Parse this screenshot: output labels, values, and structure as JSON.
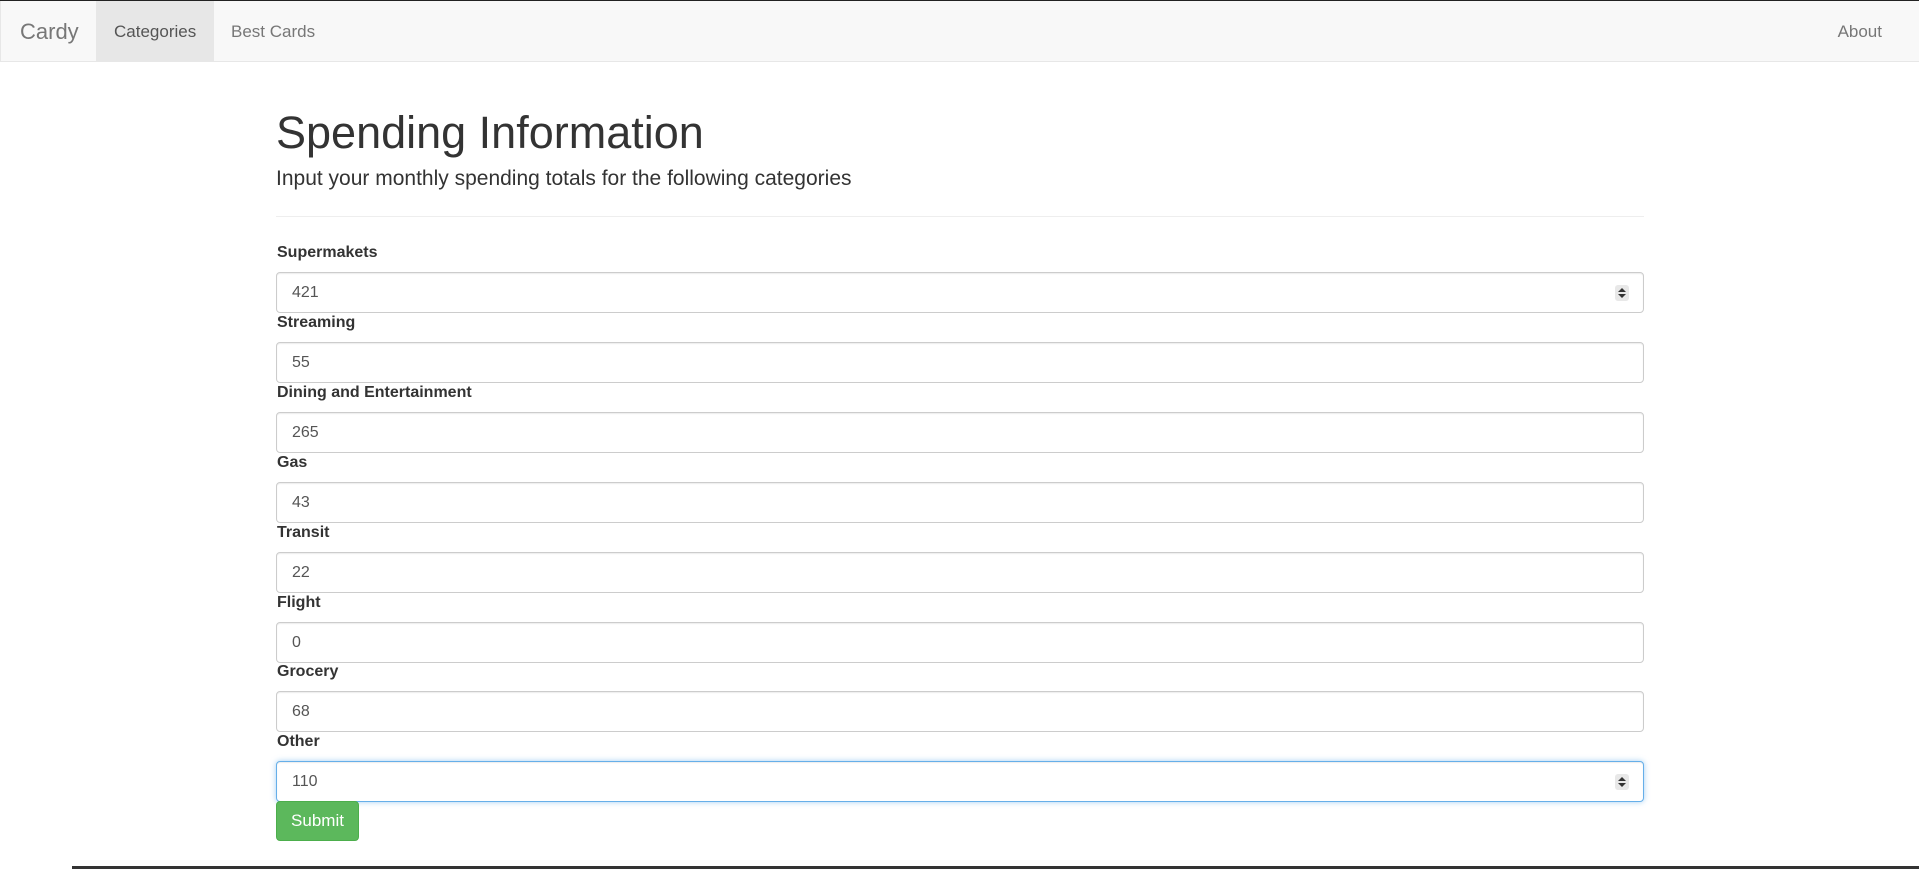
{
  "navbar": {
    "brand": "Cardy",
    "items": [
      {
        "label": "Categories",
        "active": true
      },
      {
        "label": "Best Cards",
        "active": false
      }
    ],
    "right_items": [
      {
        "label": "About"
      }
    ]
  },
  "page": {
    "title": "Spending Information",
    "subtitle": "Input your monthly spending totals for the following categories"
  },
  "fields": [
    {
      "label": "Supermakets",
      "value": "421"
    },
    {
      "label": "Streaming",
      "value": "55"
    },
    {
      "label": "Dining and Entertainment",
      "value": "265"
    },
    {
      "label": "Gas",
      "value": "43"
    },
    {
      "label": "Transit",
      "value": "22"
    },
    {
      "label": "Flight",
      "value": "0"
    },
    {
      "label": "Grocery",
      "value": "68"
    },
    {
      "label": "Other",
      "value": "110"
    }
  ],
  "form": {
    "submit_label": "Submit"
  },
  "colors": {
    "navbar_bg": "#f8f8f8",
    "active_tab_bg": "#e7e7e7",
    "submit_green": "#5cb85c",
    "focus_blue": "#66afe9"
  }
}
